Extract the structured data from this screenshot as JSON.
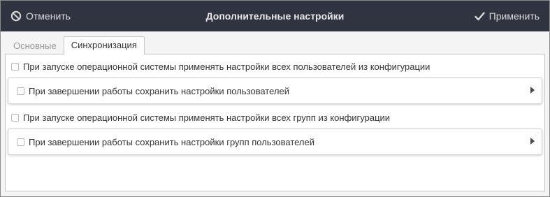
{
  "header": {
    "cancel_label": "Отменить",
    "title": "Дополнительные настройки",
    "apply_label": "Применить"
  },
  "tabs": [
    {
      "label": "Основные",
      "active": false
    },
    {
      "label": "Синхронизация",
      "active": true
    }
  ],
  "sync": {
    "apply_users_on_boot": {
      "label": "При запуске операционной системы применять настройки всех пользователей из конфигурации",
      "checked": false
    },
    "save_users_on_shutdown": {
      "label": "При завершении работы сохранить настройки пользователей",
      "checked": false,
      "expanded": false
    },
    "apply_groups_on_boot": {
      "label": "При запуске операционной системы применять настройки всех групп из конфигурации",
      "checked": false
    },
    "save_groups_on_shutdown": {
      "label": "При завершении работы сохранить настройки групп пользователей",
      "checked": false,
      "expanded": false
    }
  },
  "icons": {
    "cancel": "cancel-circle-icon",
    "apply": "checkmark-icon",
    "expand": "triangle-right-icon"
  },
  "colors": {
    "titlebar_bg": "#2f3440",
    "titlebar_text": "#e6e6e6",
    "content_bg": "#f4f4f4"
  }
}
